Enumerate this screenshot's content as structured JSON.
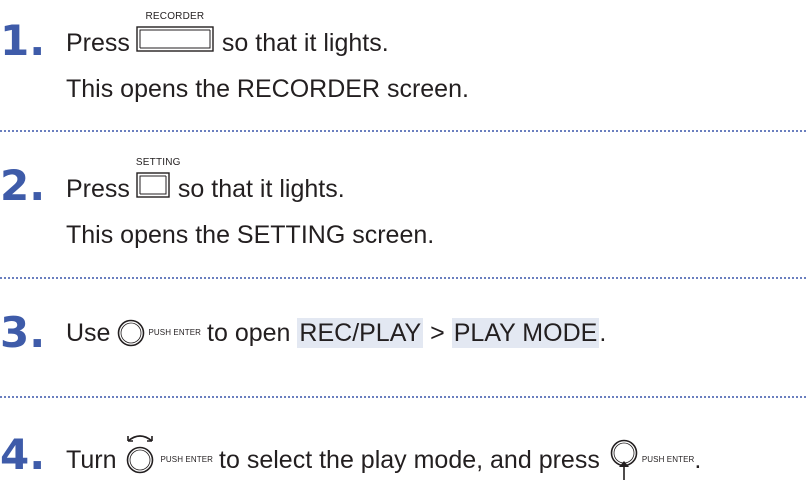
{
  "steps": [
    {
      "number": "1",
      "line1": {
        "before": "Press",
        "button_label": "RECORDER",
        "after": "so that it lights."
      },
      "line2": "This opens the RECORDER screen."
    },
    {
      "number": "2",
      "line1": {
        "before": "Press",
        "button_label": "SETTING",
        "after": "so that it lights."
      },
      "line2": "This opens the SETTING screen."
    },
    {
      "number": "3",
      "line1": {
        "before": "Use",
        "knob_label": "PUSH ENTER",
        "middle": "to open",
        "menu1": "REC/PLAY",
        "sep": ">",
        "menu2": "PLAY MODE",
        "end": "."
      }
    },
    {
      "number": "4",
      "line1": {
        "before": "Turn",
        "knob_label": "PUSH ENTER",
        "middle": "to select the play mode, and press",
        "knob_label2": "PUSH ENTER",
        "end": "."
      }
    }
  ],
  "colors": {
    "step_number": "#3e5ba9",
    "separator": "#6a7fbf",
    "highlight": "#e3e8f2",
    "text": "#231f20"
  },
  "icons": {
    "recorder_button": "rect-button-icon",
    "setting_button": "square-button-icon",
    "knob": "dial-knob-icon",
    "knob_turn": "dial-turn-icon",
    "knob_press": "dial-press-icon"
  }
}
